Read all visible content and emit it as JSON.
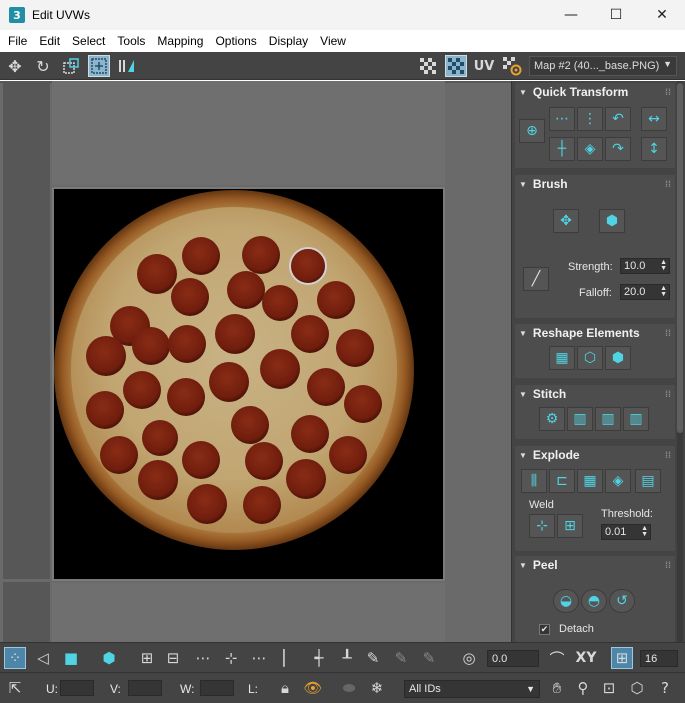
{
  "window": {
    "app_icon_text": "3",
    "title": "Edit UVWs",
    "minimize_glyph": "—",
    "maximize_glyph": "☐",
    "close_glyph": "✕"
  },
  "menu": [
    "File",
    "Edit",
    "Select",
    "Tools",
    "Mapping",
    "Options",
    "Display",
    "View"
  ],
  "toolbar": {
    "uv_label": "UV",
    "map_select": "Map #2 (40..._base.PNG)"
  },
  "panels": {
    "quick_transform": {
      "title": "Quick Transform"
    },
    "brush": {
      "title": "Brush",
      "strength_label": "Strength:",
      "strength_value": "10.0",
      "falloff_label": "Falloff:",
      "falloff_value": "20.0"
    },
    "reshape": {
      "title": "Reshape Elements"
    },
    "stitch": {
      "title": "Stitch"
    },
    "explode": {
      "title": "Explode",
      "weld_label": "Weld",
      "threshold_label": "Threshold:",
      "threshold_value": "0.01"
    },
    "peel": {
      "title": "Peel",
      "detach_label": "Detach",
      "detach_checked": true
    }
  },
  "bottom": {
    "offset_value": "0.0",
    "xy_label": "XY",
    "grid_value": "16",
    "u_label": "U:",
    "v_label": "V:",
    "w_label": "W:",
    "l_label": "L:",
    "ids_select": "All IDs"
  },
  "colors": {
    "accent": "#4fd4e4",
    "panel_bg": "#444444",
    "viewport_bg": "#6a6a6a"
  }
}
